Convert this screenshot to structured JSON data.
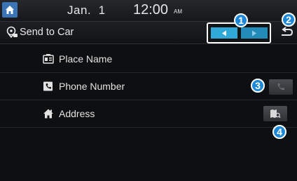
{
  "status_bar": {
    "date": "Jan.  1",
    "time": "12:00",
    "ampm": "AM"
  },
  "title": "Send to Car",
  "rows": [
    {
      "label": "Place Name",
      "icon": "place-card-icon"
    },
    {
      "label": "Phone Number",
      "icon": "phone-book-icon"
    },
    {
      "label": "Address",
      "icon": "house-icon"
    }
  ],
  "callouts": [
    "1",
    "2",
    "3",
    "4"
  ],
  "colors": {
    "accent": "#2fa9d8",
    "callout": "#1e88d8",
    "home": "#3c73b5"
  }
}
